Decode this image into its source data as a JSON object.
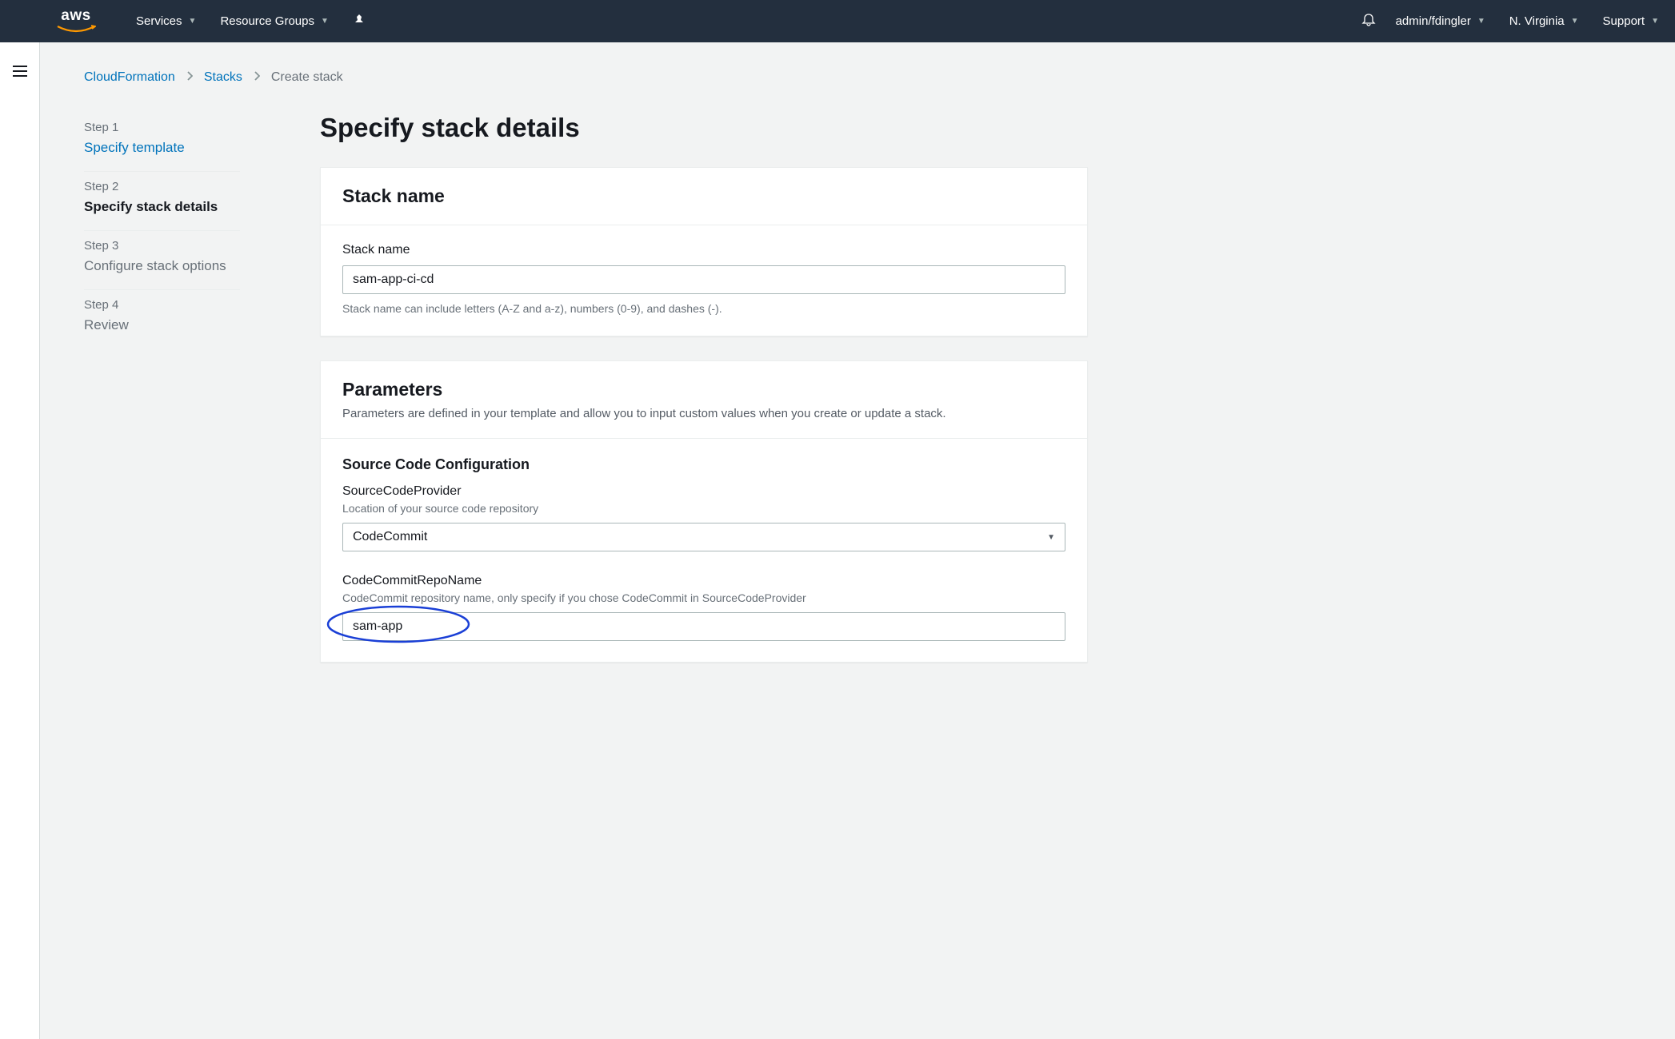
{
  "nav": {
    "logo": "aws",
    "services": "Services",
    "resource_groups": "Resource Groups",
    "user": "admin/fdingler",
    "region": "N. Virginia",
    "support": "Support"
  },
  "breadcrumb": {
    "items": [
      "CloudFormation",
      "Stacks"
    ],
    "current": "Create stack"
  },
  "steps": [
    {
      "label": "Step 1",
      "name": "Specify template",
      "state": "link"
    },
    {
      "label": "Step 2",
      "name": "Specify stack details",
      "state": "active"
    },
    {
      "label": "Step 3",
      "name": "Configure stack options",
      "state": "future"
    },
    {
      "label": "Step 4",
      "name": "Review",
      "state": "future"
    }
  ],
  "page_title": "Specify stack details",
  "stack_name_panel": {
    "title": "Stack name",
    "label": "Stack name",
    "value": "sam-app-ci-cd",
    "hint": "Stack name can include letters (A-Z and a-z), numbers (0-9), and dashes (-)."
  },
  "parameters_panel": {
    "title": "Parameters",
    "desc": "Parameters are defined in your template and allow you to input custom values when you create or update a stack.",
    "section_title": "Source Code Configuration",
    "source_code_provider": {
      "name": "SourceCodeProvider",
      "desc": "Location of your source code repository",
      "value": "CodeCommit"
    },
    "code_commit_repo": {
      "name": "CodeCommitRepoName",
      "desc": "CodeCommit repository name, only specify if you chose CodeCommit in SourceCodeProvider",
      "value": "sam-app"
    }
  }
}
